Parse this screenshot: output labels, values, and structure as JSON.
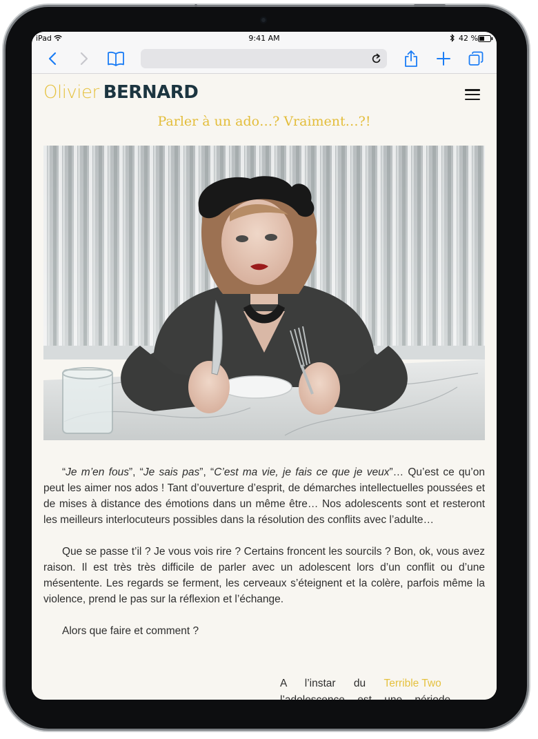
{
  "statusbar": {
    "device": "iPad",
    "time": "9:41 AM",
    "battery": "42 %"
  },
  "browser": {
    "url": ""
  },
  "site": {
    "logo_first": "Olivier",
    "logo_last": "BERNARD",
    "post_title": "Parler à un ado…? Vraiment…?!"
  },
  "article": {
    "p1_quote1": "Je m’en fous",
    "p1_sep1": "”, “",
    "p1_quote2": "Je sais pas",
    "p1_sep2": "”, “",
    "p1_quote3": "C’est ma vie, je fais ce que je veux",
    "p1_rest": "”… Qu’est ce qu’on peut les aimer nos ados ! Tant d’ouverture d’esprit, de démarches intellectuelles poussées et de mises à distance des émotions dans un même être… Nos adolescents sont et resteront les meilleurs interlocuteurs possibles dans la résolution des conflits avec l’adulte…",
    "p2": "Que se passe t’il ? Je vous vois rire ? Certains froncent les sourcils ? Bon, ok, vous avez raison. Il est très très difficile de parler avec un adolescent lors d’un conflit ou d’une mésentente. Les regards se ferment, les cerveaux s’éteignent et la colère, parfois même la violence, prend le pas sur la réflexion et l’échange.",
    "p3": "Alors que faire et comment ?",
    "teaser_start": "A l’instar du",
    "teaser_link": "Terrible Two",
    "teaser_line2": "l’adolescence est une période"
  },
  "colors": {
    "accent": "#e5c13f",
    "logo_dark": "#1c3540",
    "ios_blue": "#1a7cf5",
    "page_bg": "#f8f6f1"
  },
  "icons": [
    "back-icon",
    "forward-icon",
    "bookmarks-icon",
    "reload-icon",
    "share-icon",
    "add-tab-icon",
    "tabs-icon",
    "wifi-icon",
    "bluetooth-icon",
    "battery-icon",
    "hamburger-menu-icon"
  ]
}
